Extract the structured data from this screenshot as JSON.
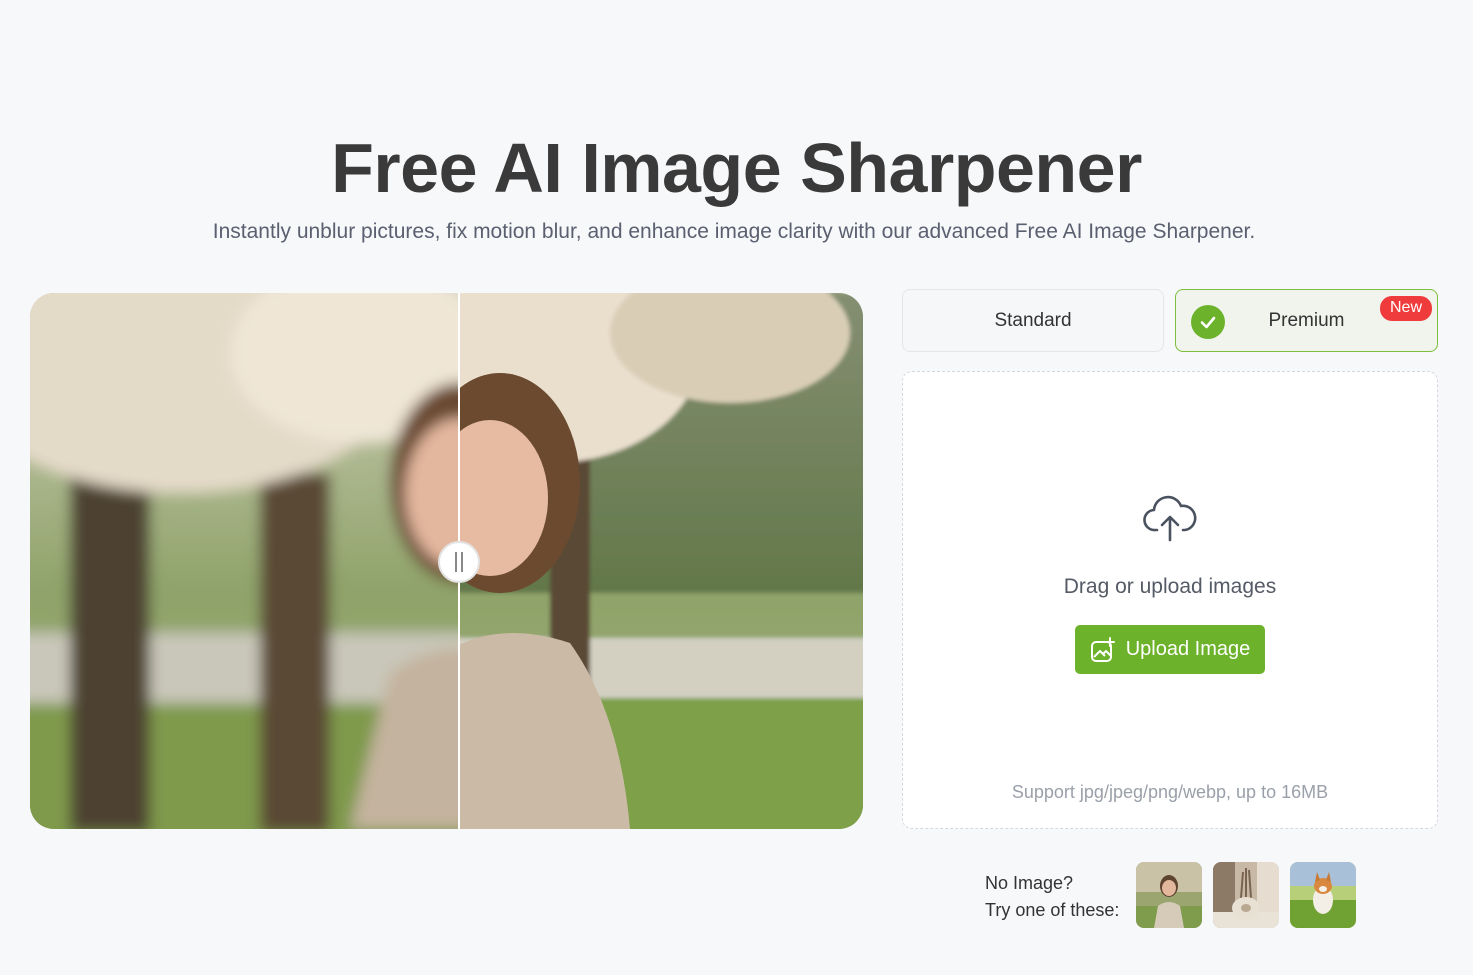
{
  "hero": {
    "title": "Free AI Image Sharpener",
    "subtitle": "Instantly unblur pictures, fix motion blur, and enhance image clarity with our advanced Free AI Image Sharpener."
  },
  "compare": {
    "slider_position_fraction": 0.515
  },
  "modes": {
    "standard_label": "Standard",
    "premium_label": "Premium",
    "new_badge": "New",
    "selected": "Premium"
  },
  "upload": {
    "drag_text": "Drag or upload images",
    "button_label": "Upload Image",
    "support_text": "Support jpg/jpeg/png/webp, up to 16MB"
  },
  "samples": {
    "line1": "No Image?",
    "line2": "Try one of these:",
    "items": [
      "woman-portrait",
      "ceramic-vase",
      "corgi-dog"
    ]
  },
  "colors": {
    "accent_green": "#6cb22a",
    "badge_red": "#ef3b3b",
    "background": "#f7f8fa"
  }
}
